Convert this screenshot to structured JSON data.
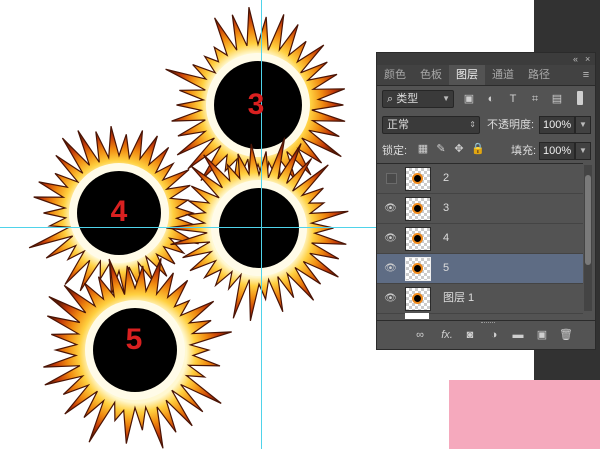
{
  "canvas": {
    "bursts": [
      {
        "label": "3"
      },
      {
        "label": "4"
      },
      {
        "label": ""
      },
      {
        "label": "5"
      }
    ]
  },
  "panel": {
    "tabs": [
      {
        "label": "颜色"
      },
      {
        "label": "色板"
      },
      {
        "label": "图层",
        "active": true
      },
      {
        "label": "通道"
      },
      {
        "label": "路径"
      }
    ],
    "filter": {
      "search_icon": "search-icon",
      "value": "类型"
    },
    "blend_mode": {
      "value": "正常"
    },
    "opacity": {
      "label": "不透明度:",
      "value": "100%"
    },
    "lock": {
      "label": "锁定:"
    },
    "fill": {
      "label": "填充:",
      "value": "100%"
    },
    "layers": [
      {
        "name": "2",
        "visible": false,
        "selected": false
      },
      {
        "name": "3",
        "visible": true,
        "selected": false
      },
      {
        "name": "4",
        "visible": true,
        "selected": false
      },
      {
        "name": "5",
        "visible": true,
        "selected": true
      },
      {
        "name": "图层 1",
        "visible": true,
        "selected": false
      }
    ],
    "footer": {
      "fx_label": "fx."
    }
  },
  "colors": {
    "accent_selected": "#5e6c84",
    "guide": "#4fd3ea",
    "number": "#d92020"
  }
}
